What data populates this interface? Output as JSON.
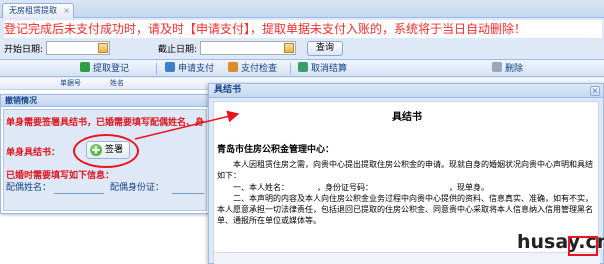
{
  "tab": {
    "label": "无房租赁提取",
    "close": "×"
  },
  "notice": "登记完成后未支付成功时，请及时【申请支付】，提取单据未支付入账的，系统将于当日自动删除！",
  "search": {
    "start_label": "开始日期:",
    "end_label": "截止日期:",
    "query_label": "查询"
  },
  "toolbar": {
    "items": [
      {
        "label": "提取登记",
        "color": "#2ea043"
      },
      {
        "label": "申请支付",
        "color": "#3d7fd1"
      },
      {
        "label": "支付检查",
        "color": "#d98c2b"
      },
      {
        "label": "取消结算",
        "color": "#3b9c6e"
      },
      {
        "label": "删除",
        "color": "#9aa7b8"
      }
    ]
  },
  "grid": {
    "col1": "单据号",
    "col2": "姓名"
  },
  "window1": {
    "title": "撤销情况",
    "line1": "单身需要签署具结书，已婚需要填写配偶姓名、身",
    "sign_label": "单身具结书：",
    "sign_button": "签署",
    "married_label": "已婚时需要填写如下信息：",
    "spouse_name_label": "配偶姓名：",
    "spouse_id_label": "配偶身份证："
  },
  "window2": {
    "title": "具结书",
    "close": "×",
    "doc_title": "具结书",
    "addressee": "青岛市住房公积金管理中心：",
    "para1": "本人因租赁住房之需，向贵中心提出提取住房公积金的申请。现就自身的婚姻状况向贵中心声明和具结如下：",
    "para2": "一、本人姓名：　　　　，身份证号码：　　　　　　　　　　，现单身。",
    "para3": "二、本声明的内容及本人向住房公积金业务过程中向贵中心提供的资料、信息真实、准确，如有不实，本人愿意承担一切法律责任，包括退回已提取的住房公积金、同意贵中心采取将本人信息纳入信用管理黑名单、通报所在单位或媒体等。"
  },
  "watermark": {
    "text": "husay.cn"
  },
  "colors": {
    "notice_red": "#ff2a2a",
    "annotation_red": "#e8141e",
    "window_border": "#99bbe8",
    "text_blue": "#15428b"
  }
}
